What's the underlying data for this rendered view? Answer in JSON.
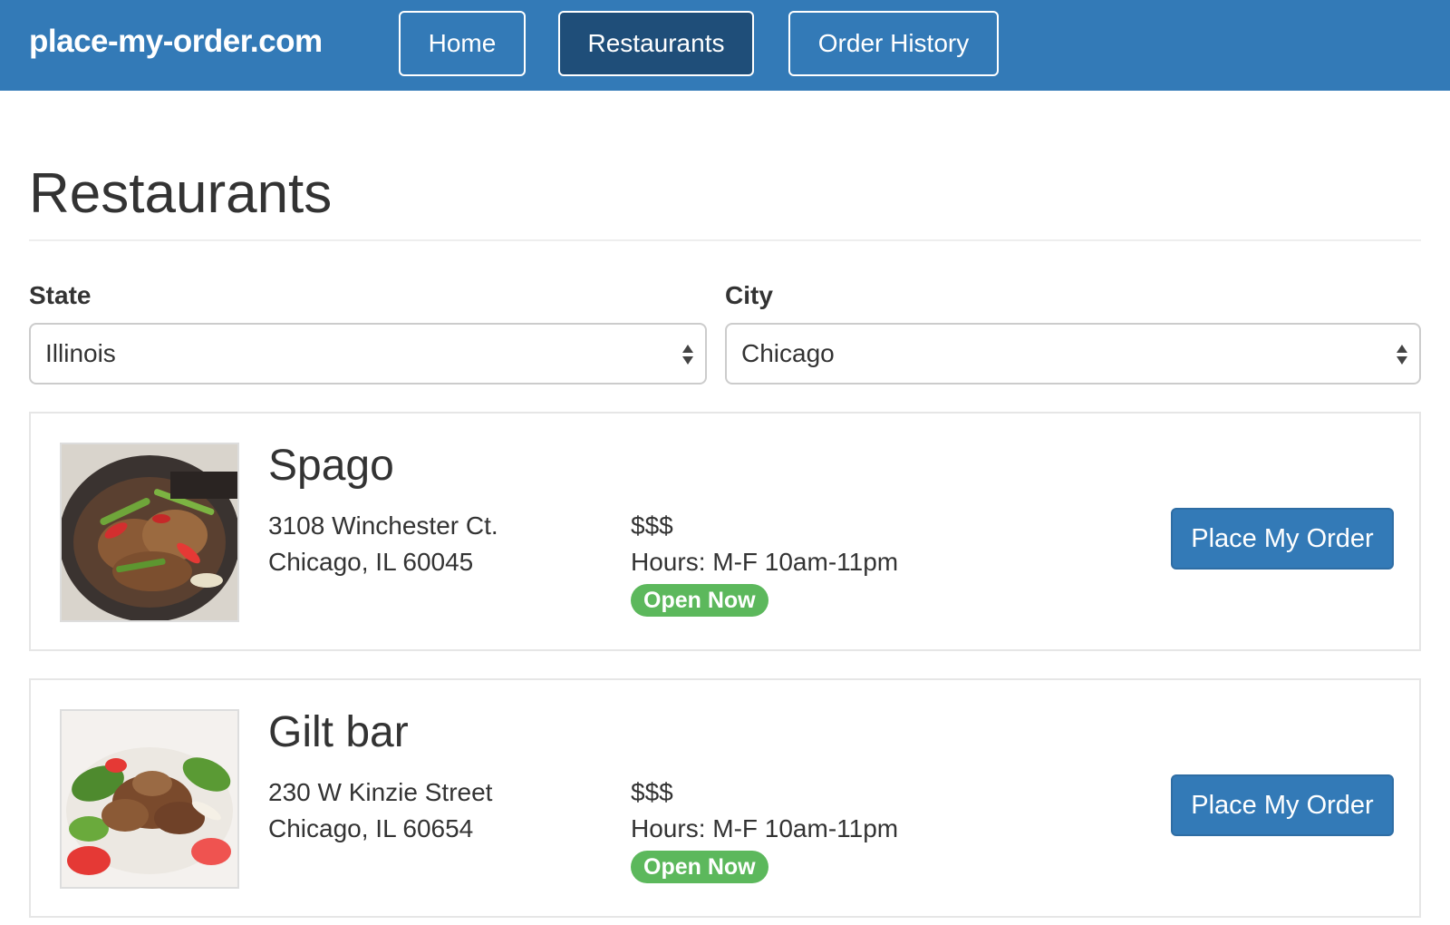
{
  "nav": {
    "brand": "place-my-order.com",
    "items": [
      {
        "label": "Home",
        "active": false
      },
      {
        "label": "Restaurants",
        "active": true
      },
      {
        "label": "Order History",
        "active": false
      }
    ]
  },
  "page": {
    "title": "Restaurants"
  },
  "filters": {
    "state": {
      "label": "State",
      "value": "Illinois"
    },
    "city": {
      "label": "City",
      "value": "Chicago"
    }
  },
  "restaurants": [
    {
      "name": "Spago",
      "address_line1": "3108 Winchester Ct.",
      "address_line2": "Chicago, IL 60045",
      "price": "$$$",
      "hours": "Hours: M-F 10am-11pm",
      "status": "Open Now",
      "action_label": "Place My Order",
      "image_icon": "food-photo-stir-fry"
    },
    {
      "name": "Gilt bar",
      "address_line1": "230 W Kinzie Street",
      "address_line2": "Chicago, IL 60654",
      "price": "$$$",
      "hours": "Hours: M-F 10am-11pm",
      "status": "Open Now",
      "action_label": "Place My Order",
      "image_icon": "food-photo-beef-salad"
    }
  ],
  "colors": {
    "navbar": "#337ab7",
    "nav_active": "#1f4e79",
    "primary_button": "#337ab7",
    "open_badge": "#5cb85c"
  }
}
